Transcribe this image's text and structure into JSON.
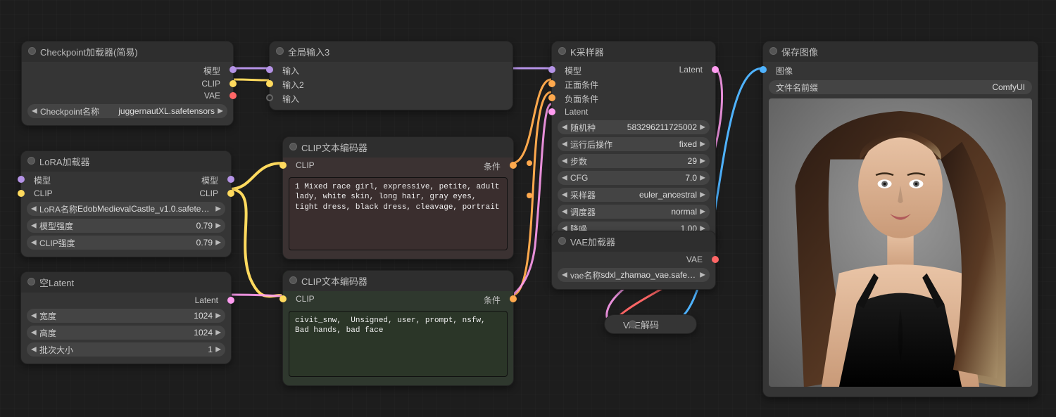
{
  "checkpoint": {
    "title": "Checkpoint加载器(简易)",
    "out_model": "模型",
    "out_clip": "CLIP",
    "out_vae": "VAE",
    "w_name_label": "Checkpoint名称",
    "w_name_value": "juggernautXL.safetensors"
  },
  "lora": {
    "title": "LoRA加载器",
    "in_model": "模型",
    "in_clip": "CLIP",
    "out_model": "模型",
    "out_clip": "CLIP",
    "w_name_label": "LoRA名称",
    "w_name_value": "EdobMedievalCastle_v1.0.safetensors",
    "w_model_str_label": "模型强度",
    "w_model_str_value": "0.79",
    "w_clip_str_label": "CLIP强度",
    "w_clip_str_value": "0.79"
  },
  "empty_latent": {
    "title": "空Latent",
    "out_latent": "Latent",
    "w_width_label": "宽度",
    "w_width_value": "1024",
    "w_height_label": "高度",
    "w_height_value": "1024",
    "w_batch_label": "批次大小",
    "w_batch_value": "1"
  },
  "reroute": {
    "title": "全局输入3",
    "in1": "输入",
    "in2": "输入2",
    "in3": "输入"
  },
  "clip_pos": {
    "title": "CLIP文本编码器",
    "in_clip": "CLIP",
    "out_cond": "条件",
    "prompt": "1 Mixed race girl, expressive, petite, adult lady, white skin, long hair, gray eyes, tight dress, black dress, cleavage, portrait"
  },
  "clip_neg": {
    "title": "CLIP文本编码器",
    "in_clip": "CLIP",
    "out_cond": "条件",
    "prompt": "civit_snw,  Unsigned, user, prompt, nsfw,  Bad hands, bad face"
  },
  "ksampler": {
    "title": "K采样器",
    "in_model": "模型",
    "in_positive": "正面条件",
    "in_negative": "负面条件",
    "in_latent": "Latent",
    "out_latent": "Latent",
    "w_seed_label": "随机种",
    "w_seed_value": "583296211725002",
    "w_after_label": "运行后操作",
    "w_after_value": "fixed",
    "w_steps_label": "步数",
    "w_steps_value": "29",
    "w_cfg_label": "CFG",
    "w_cfg_value": "7.0",
    "w_sampler_label": "采样器",
    "w_sampler_value": "euler_ancestral",
    "w_sched_label": "调度器",
    "w_sched_value": "normal",
    "w_denoise_label": "降噪",
    "w_denoise_value": "1.00"
  },
  "vae_loader": {
    "title": "VAE加载器",
    "out_vae": "VAE",
    "w_name_label": "vae名称",
    "w_name_value": "sdxl_zhamao_vae.safetensors"
  },
  "vae_decode": {
    "title": "VAE解码"
  },
  "save": {
    "title": "保存图像",
    "in_image": "图像",
    "w_prefix_label": "文件名前缀",
    "w_prefix_value": "ComfyUI"
  },
  "colors": {
    "model": "#b593e6",
    "clip": "#ffda5e",
    "vae": "#ff6666",
    "latent": "#ff9cf0",
    "cond": "#ffa94d",
    "image": "#4fb3ff"
  }
}
